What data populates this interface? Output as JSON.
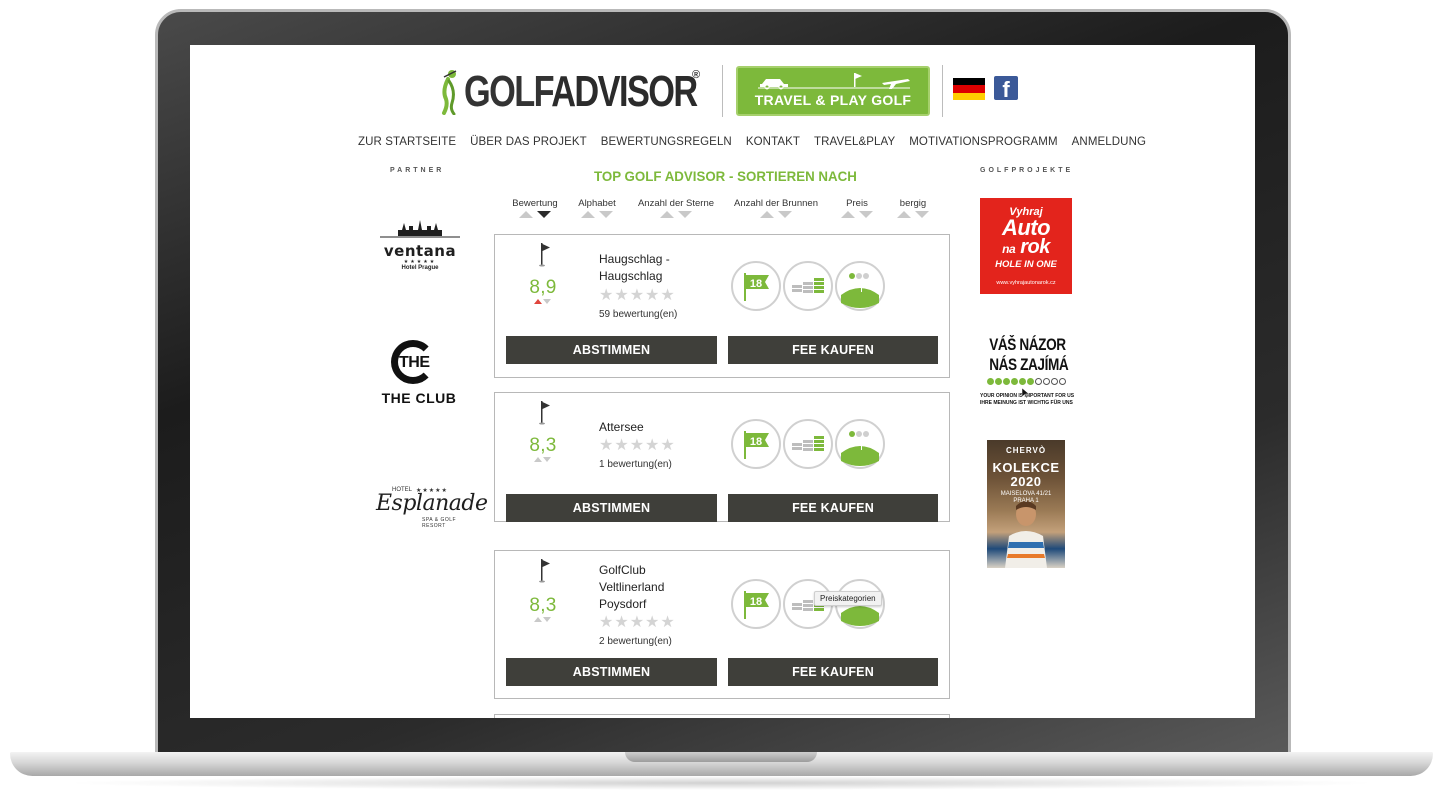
{
  "brand": {
    "logo_text_1": "GOLF",
    "logo_text_2": "ADVISOR",
    "logo_mark": "®",
    "travel_button": "TRAVEL & PLAY GOLF",
    "green": "#7db93b",
    "dark_button": "#3f3f3a"
  },
  "header_icons": [
    "germany-flag-icon",
    "facebook-icon"
  ],
  "nav": {
    "items": [
      "ZUR STARTSEITE",
      "ÜBER DAS PROJEKT",
      "BEWERTUNGSREGELN",
      "KONTAKT",
      "TRAVEL&PLAY",
      "MOTIVATIONSPROGRAMM",
      "ANMELDUNG"
    ]
  },
  "left": {
    "heading": "PARTNER",
    "ventana": {
      "name": "ventana",
      "stars": "★★★★★",
      "sub": "Hotel Prague"
    },
    "theclub": {
      "the": "THE",
      "club": "THE CLUB"
    },
    "esplanade": {
      "hotel": "HOTEL",
      "stars": "★★★★★",
      "name": "Esplanade",
      "sub": "SPA & GOLF RESORT"
    }
  },
  "main": {
    "title": "TOP GOLF ADVISOR - SORTIEREN NACH",
    "sort": [
      "Bewertung",
      "Alphabet",
      "Anzahl der Sterne",
      "Anzahl der Brunnen",
      "Preis",
      "bergig"
    ],
    "cards": [
      {
        "score": "8,9",
        "name": "Haugschlag - Haugschlag",
        "stars": "★★★★★",
        "reviews": "59 bewertung(en)",
        "holes": "18",
        "vote": "ABSTIMMEN",
        "fee": "FEE KAUFEN"
      },
      {
        "score": "8,3",
        "name": "Attersee",
        "stars": "★★★★★",
        "reviews": "1 bewertung(en)",
        "holes": "18",
        "vote": "ABSTIMMEN",
        "fee": "FEE KAUFEN"
      },
      {
        "score": "8,3",
        "name": "GolfClub Veltlinerland Poysdorf",
        "stars": "★★★★★",
        "reviews": "2 bewertung(en)",
        "holes": "18",
        "vote": "ABSTIMMEN",
        "fee": "FEE KAUFEN"
      }
    ],
    "tooltip": "Preiskategorien"
  },
  "right": {
    "heading": "GOLFPROJEKTE",
    "ad_auto": {
      "l1": "Vyhraj",
      "l2": "Auto",
      "l3a": "na",
      "l3b": "rok",
      "l4": "HOLE IN ONE",
      "l5": "www.vyhrajautonarok.cz"
    },
    "ad_opinion": {
      "l1": "VÁŠ NÁZOR",
      "l2": "NÁS ZAJÍMÁ",
      "l3": "YOUR OPINION IS IMPORTANT FOR US",
      "l4": "IHRE MEINUNG IST WICHTIG FÜR UNS"
    },
    "ad_chervo": {
      "brand": "CHERVÒ",
      "k1": "KOLEKCE",
      "k2": "2020",
      "k3": "MAISELOVA 41/21",
      "k4": "PRAHA 1"
    }
  }
}
